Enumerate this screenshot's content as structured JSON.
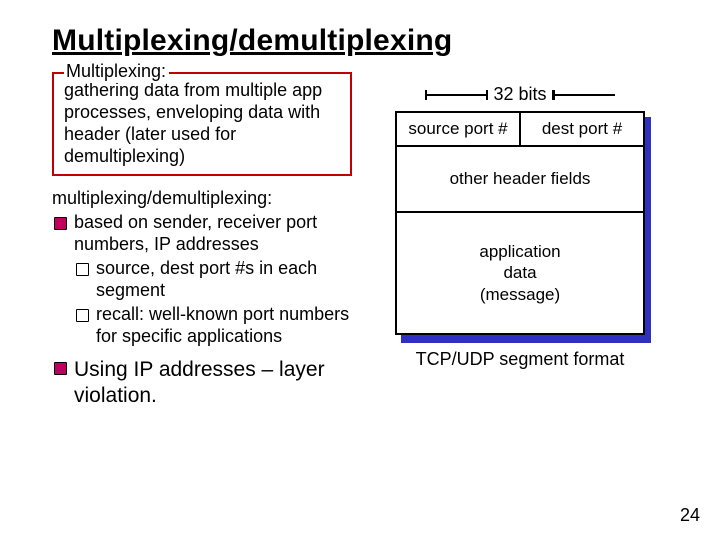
{
  "title": "Multiplexing/demultiplexing",
  "box": {
    "legend": "Multiplexing:",
    "body": "gathering data from multiple app processes, enveloping data with header (later used for demultiplexing)"
  },
  "mux": {
    "title": "multiplexing/demultiplexing:",
    "l1a": "based on sender, receiver port numbers, IP addresses",
    "l2a": "source, dest port #s in each segment",
    "l2b": "recall: well-known port numbers for specific applications",
    "final": "Using IP addresses – layer violation."
  },
  "diagram": {
    "bits": "32 bits",
    "src": "source port #",
    "dst": "dest port #",
    "other": "other header fields",
    "payload": "application\ndata\n(message)",
    "caption": "TCP/UDP segment format"
  },
  "page": "24"
}
